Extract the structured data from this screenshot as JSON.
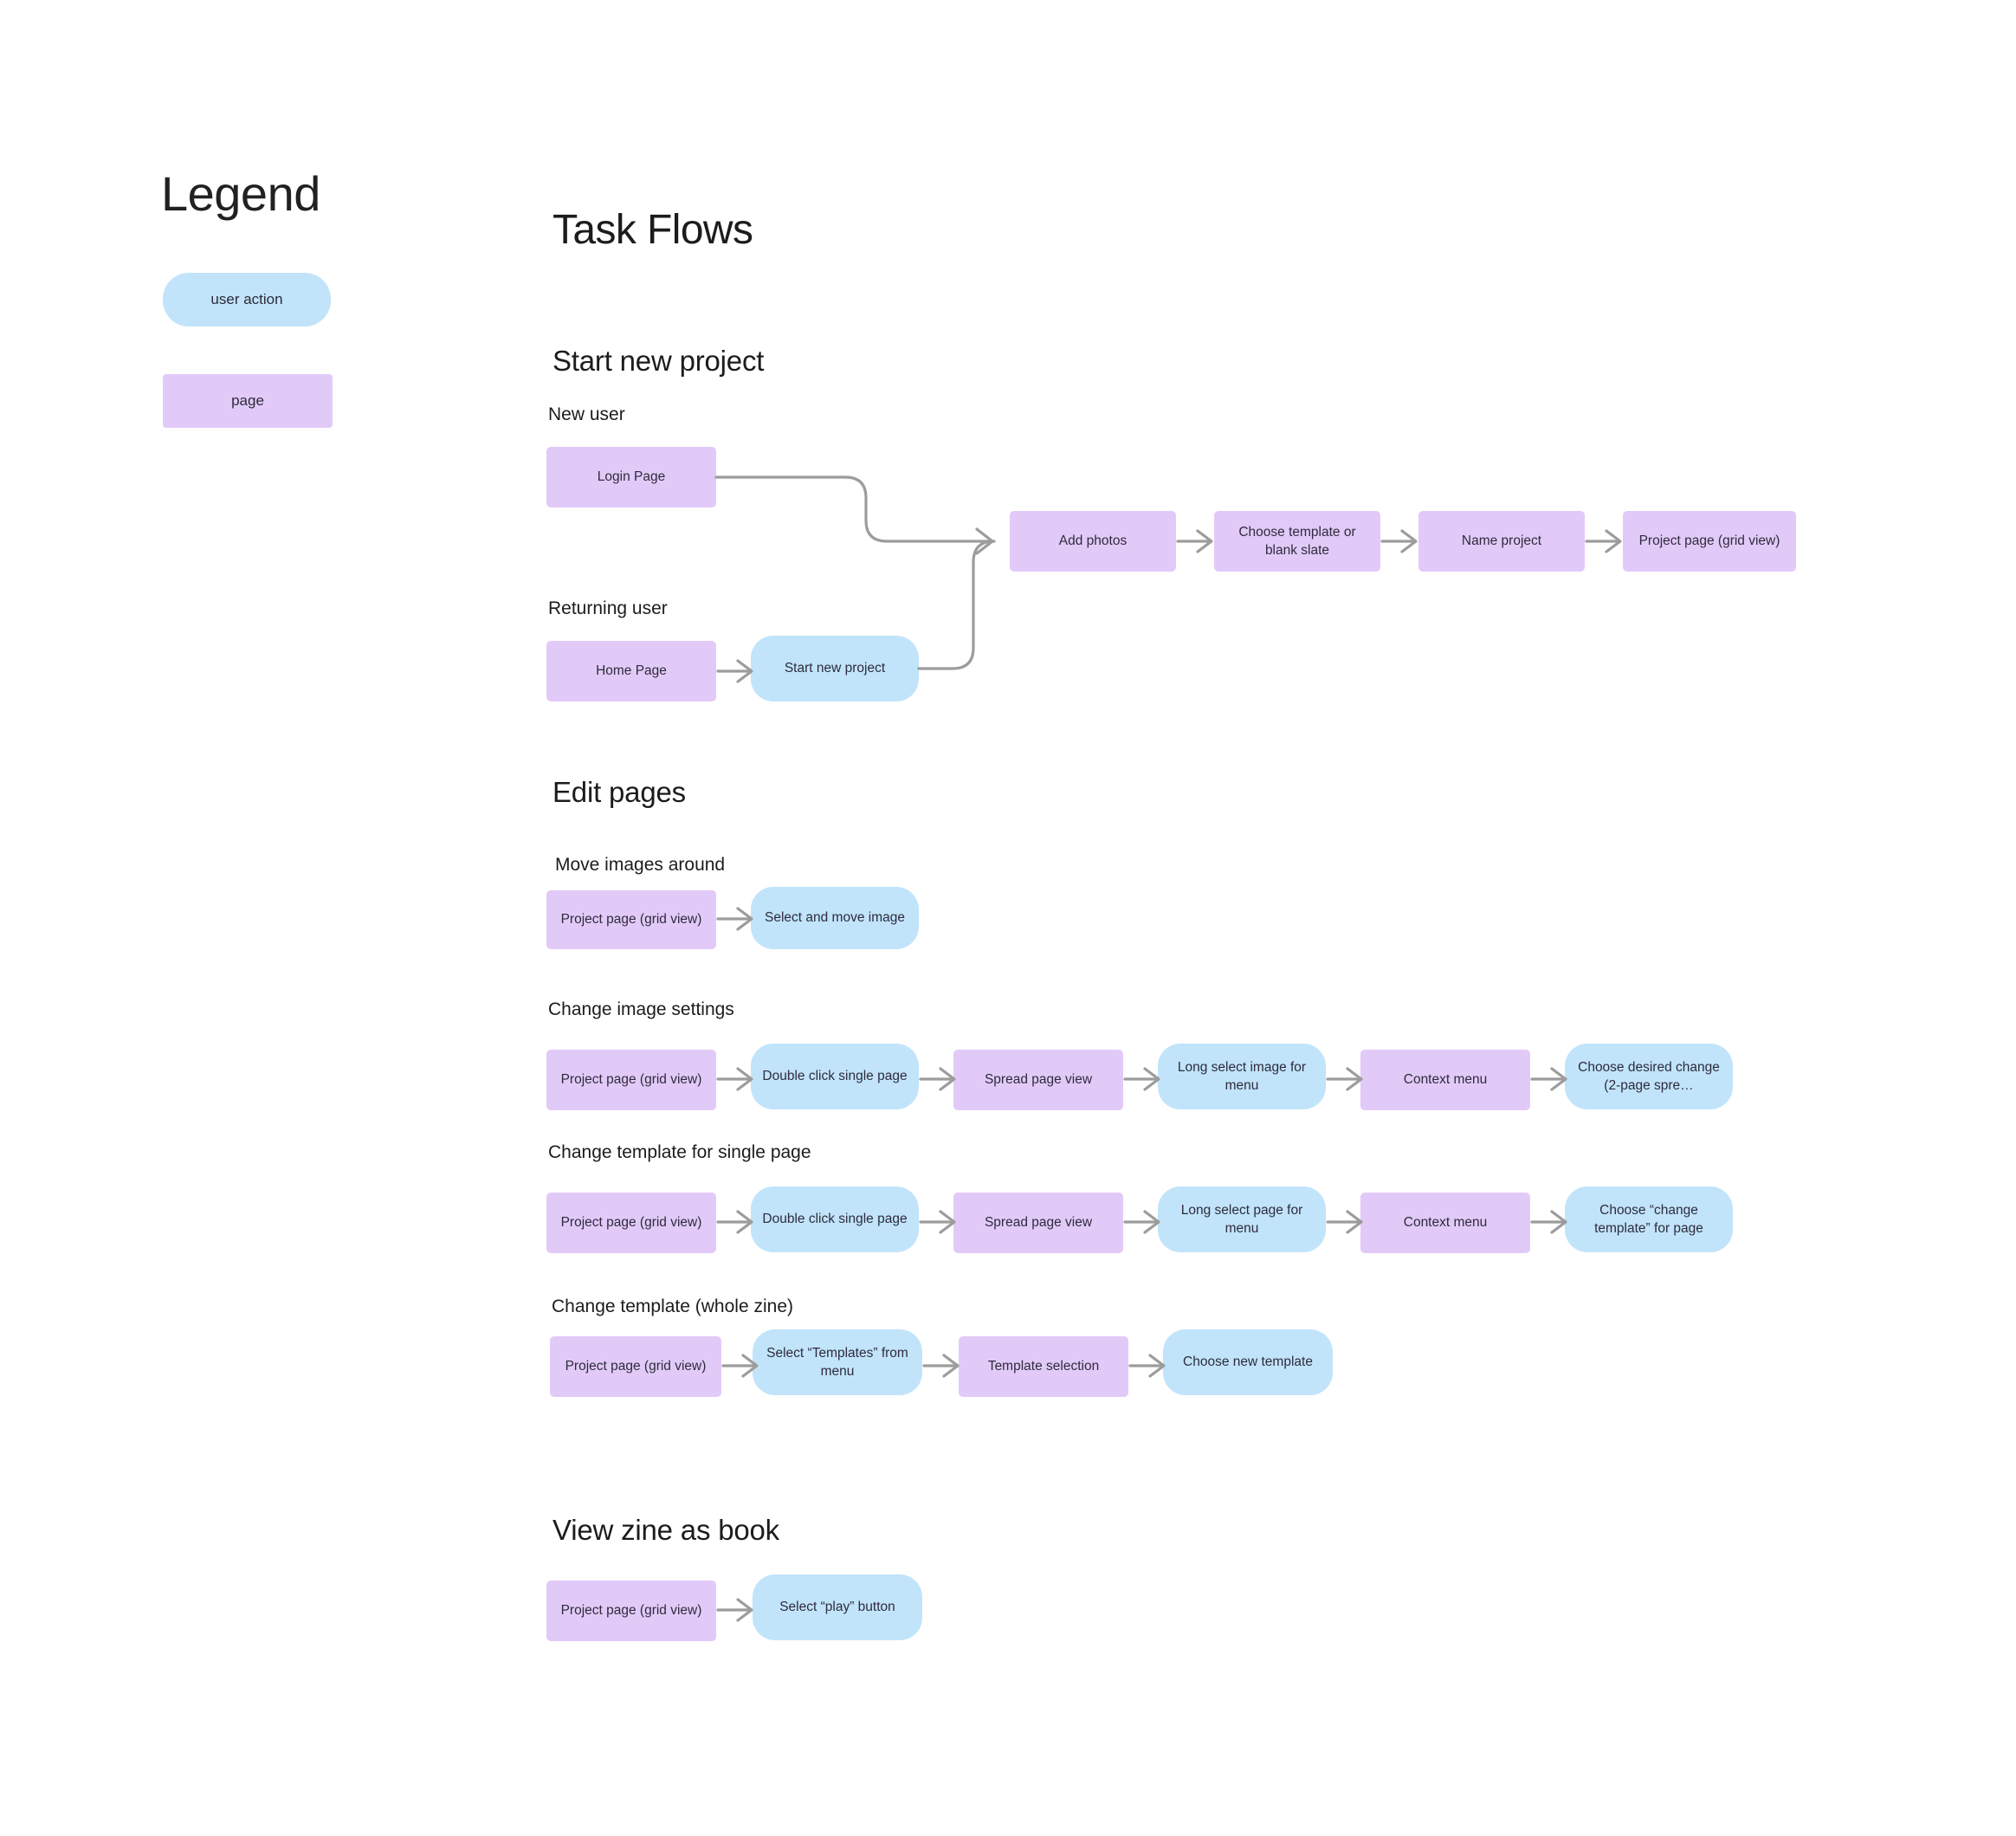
{
  "legend": {
    "title": "Legend",
    "items": [
      {
        "label": "user action",
        "kind": "action"
      },
      {
        "label": "page",
        "kind": "page"
      }
    ]
  },
  "page_title": "Task Flows",
  "sections": [
    {
      "title": "Start new project",
      "flows": [
        {
          "label": "New user",
          "nodes": [
            {
              "label": "Login Page",
              "kind": "page"
            },
            {
              "label": "Add photos",
              "kind": "page"
            },
            {
              "label": "Choose template or blank slate",
              "kind": "page"
            },
            {
              "label": "Name project",
              "kind": "page"
            },
            {
              "label": "Project page (grid view)",
              "kind": "page"
            }
          ]
        },
        {
          "label": "Returning user",
          "nodes": [
            {
              "label": "Home Page",
              "kind": "page"
            },
            {
              "label": "Start new project",
              "kind": "action"
            }
          ]
        }
      ]
    },
    {
      "title": "Edit pages",
      "flows": [
        {
          "label": "Move images around",
          "nodes": [
            {
              "label": "Project page (grid view)",
              "kind": "page"
            },
            {
              "label": "Select and move image",
              "kind": "action"
            }
          ]
        },
        {
          "label": "Change image settings",
          "nodes": [
            {
              "label": "Project page (grid view)",
              "kind": "page"
            },
            {
              "label": "Double click single page",
              "kind": "action"
            },
            {
              "label": "Spread page view",
              "kind": "page"
            },
            {
              "label": "Long select image for menu",
              "kind": "action"
            },
            {
              "label": "Context menu",
              "kind": "page"
            },
            {
              "label": "Choose desired change (2-page spre…",
              "kind": "action"
            }
          ]
        },
        {
          "label": "Change template for single page",
          "nodes": [
            {
              "label": "Project page (grid view)",
              "kind": "page"
            },
            {
              "label": "Double click single page",
              "kind": "action"
            },
            {
              "label": "Spread page view",
              "kind": "page"
            },
            {
              "label": "Long select page for menu",
              "kind": "action"
            },
            {
              "label": "Context menu",
              "kind": "page"
            },
            {
              "label": "Choose “change template” for page",
              "kind": "action"
            }
          ]
        },
        {
          "label": "Change template (whole zine)",
          "nodes": [
            {
              "label": "Project page (grid view)",
              "kind": "page"
            },
            {
              "label": "Select “Templates” from menu",
              "kind": "action"
            },
            {
              "label": "Template selection",
              "kind": "page"
            },
            {
              "label": "Choose new template",
              "kind": "action"
            }
          ]
        }
      ]
    },
    {
      "title": "View zine as book",
      "flows": [
        {
          "label": "",
          "nodes": [
            {
              "label": "Project page (grid view)",
              "kind": "page"
            },
            {
              "label": "Select “play” button",
              "kind": "action"
            }
          ]
        }
      ]
    }
  ],
  "colors": {
    "page_fill": "#e2caf8",
    "action_fill": "#c1e4fa",
    "connector": "#9c9c9c",
    "text": "#2e2b3d",
    "heading": "#1c1c1c",
    "background": "#ffffff"
  }
}
